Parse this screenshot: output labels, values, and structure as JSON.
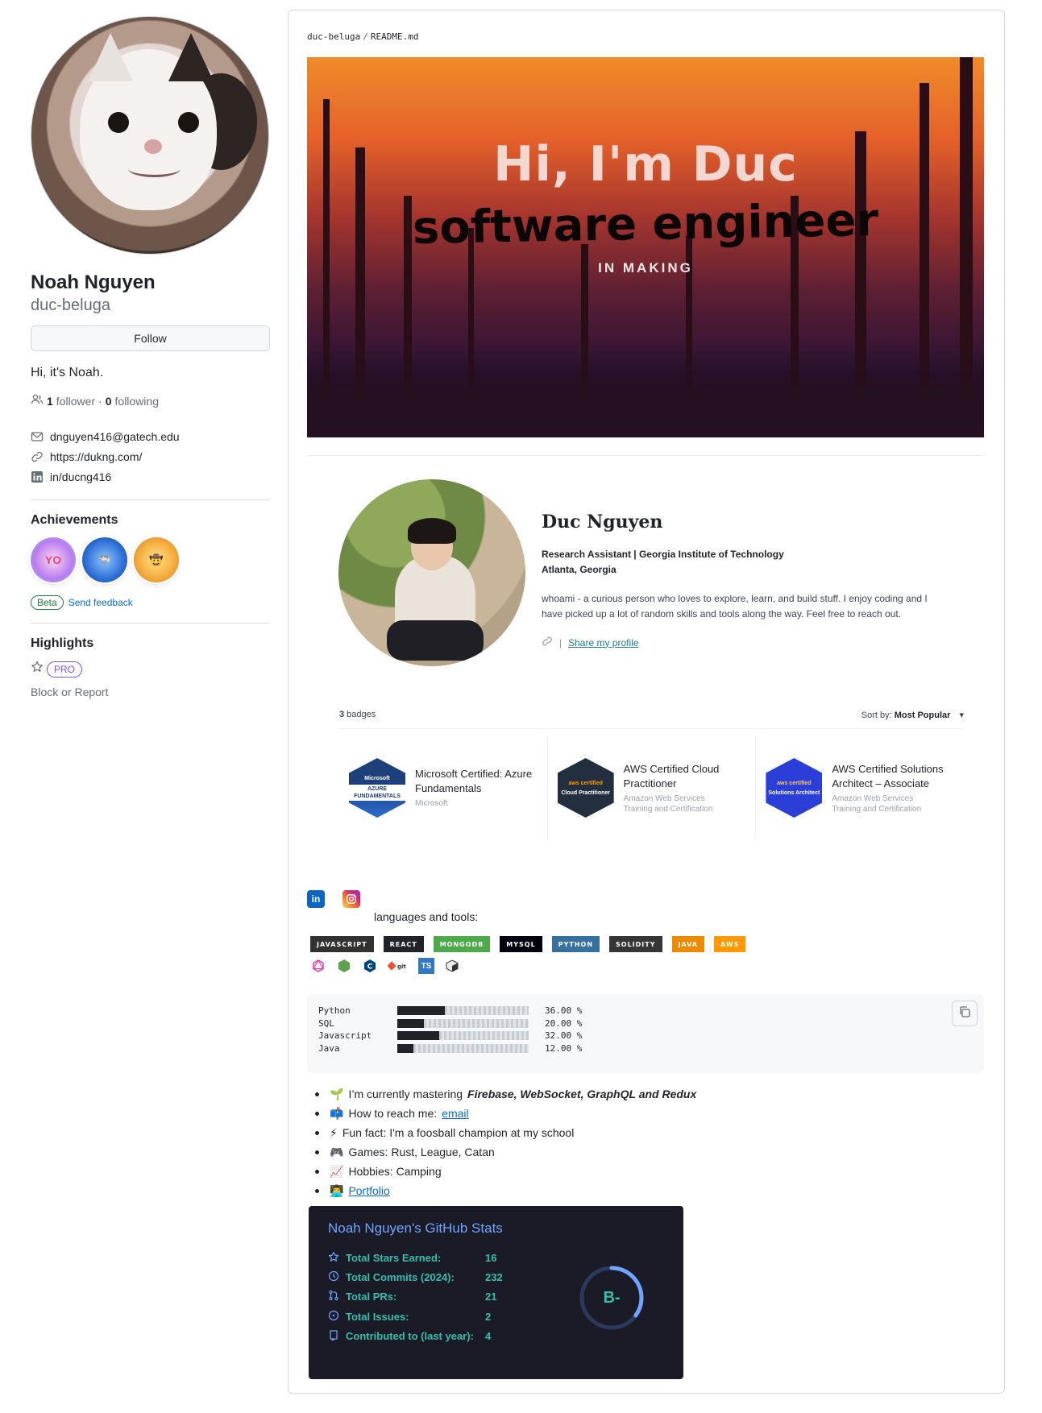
{
  "sidebar": {
    "name": "Noah Nguyen",
    "login": "duc-beluga",
    "follow_label": "Follow",
    "bio": "Hi, it's Noah.",
    "followers_count": "1",
    "followers_label": "follower",
    "following_count": "0",
    "following_label": "following",
    "dot": "·",
    "email": "dnguyen416@gatech.edu",
    "website": "https://dukng.com/",
    "linkedin": "in/ducng416",
    "achievements_title": "Achievements",
    "beta_label": "Beta",
    "feedback_label": "Send feedback",
    "highlights_title": "Highlights",
    "pro_label": "PRO",
    "block_label": "Block or Report"
  },
  "readme": {
    "repo": "duc-beluga",
    "file": "README.md",
    "banner": {
      "line1": "Hi, I'm Duc",
      "line2": "software engineer",
      "line3": "IN MAKING"
    },
    "profile": {
      "name": "Duc Nguyen",
      "role": "Research Assistant | Georgia Institute of Technology",
      "location": "Atlanta, Georgia",
      "about": "whoami - a curious person who loves to explore, learn, and build stuff. I enjoy coding and I have picked up a lot of random skills and tools along the way. Feel free to reach out.",
      "share_label": "Share my profile"
    },
    "badges": {
      "count_label": "3 badges",
      "count": "3",
      "sort_label": "Sort by:",
      "sort_value": "Most Popular",
      "items": [
        {
          "title": "Microsoft Certified: Azure Fundamentals",
          "issuer": "Microsoft",
          "extra": "",
          "hex_line1": "Microsoft",
          "hex_line2": "AZURE FUNDAMENTALS"
        },
        {
          "title": "AWS Certified Cloud Practitioner",
          "issuer": "Amazon Web Services",
          "extra": "Training and Certification",
          "hex_line1": "aws certified",
          "hex_line2": "Cloud Practitioner"
        },
        {
          "title": "AWS Certified Solutions Architect – Associate",
          "issuer": "Amazon Web Services",
          "extra": "Training and Certification",
          "hex_line1": "aws certified",
          "hex_line2": "Solutions Architect"
        }
      ]
    },
    "languages_label": "languages and tools:",
    "tags": [
      {
        "label": "JAVASCRIPT",
        "color": "#323330"
      },
      {
        "label": "REACT",
        "color": "#20232a"
      },
      {
        "label": "MONGODB",
        "color": "#4ea94b"
      },
      {
        "label": "MYSQL",
        "color": "#00000f"
      },
      {
        "label": "PYTHON",
        "color": "#3670a0"
      },
      {
        "label": "SOLIDITY",
        "color": "#363636"
      },
      {
        "label": "JAVA",
        "color": "#ed8b00"
      },
      {
        "label": "AWS",
        "color": "#ff9900"
      }
    ],
    "code_stats": [
      {
        "name": "Python",
        "pct": "36.00 %",
        "value": 0.36
      },
      {
        "name": "SQL",
        "pct": "20.00 %",
        "value": 0.2
      },
      {
        "name": "Javascript",
        "pct": "32.00 %",
        "value": 0.32
      },
      {
        "name": "Java",
        "pct": "12.00 %",
        "value": 0.12
      }
    ],
    "bullets": {
      "b1_emoji": "🌱",
      "b1_text": "I’m currently mastering",
      "b1_em": "Firebase, WebSocket, GraphQL and Redux",
      "b2_emoji": "📫",
      "b2_text": "How to reach me:",
      "b2_link": "email",
      "b3_emoji": "⚡",
      "b3_text": "Fun fact: I'm a foosball champion at my school",
      "b4_emoji": "🎮",
      "b4_text": "Games: Rust, League, Catan",
      "b5_emoji": "📈",
      "b5_text": "Hobbies: Camping",
      "b6_emoji": "👨‍💻",
      "b6_link": "Portfolio"
    },
    "github_stats": {
      "title": "Noah Nguyen's GitHub Stats",
      "rows": [
        {
          "label": "Total Stars Earned:",
          "value": "16",
          "icon": "star-icon"
        },
        {
          "label": "Total Commits (2024):",
          "value": "232",
          "icon": "history-icon"
        },
        {
          "label": "Total PRs:",
          "value": "21",
          "icon": "pr-icon"
        },
        {
          "label": "Total Issues:",
          "value": "2",
          "icon": "issue-icon"
        },
        {
          "label": "Contributed to (last year):",
          "value": "4",
          "icon": "repo-icon"
        }
      ],
      "grade": "B-",
      "progress": 0.35
    }
  }
}
